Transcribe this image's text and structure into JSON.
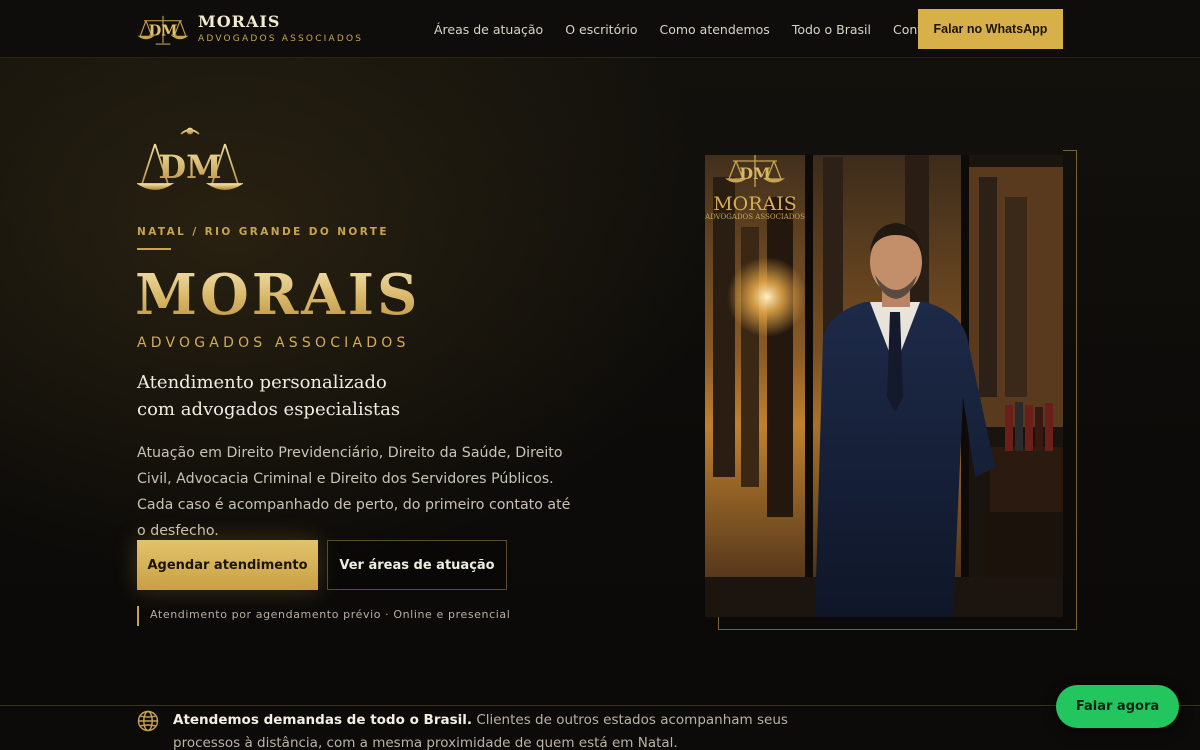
{
  "nav": {
    "brand_name": "MORAIS",
    "brand_sub": "ADVOGADOS ASSOCIADOS",
    "links": [
      "Áreas de atuação",
      "O escritório",
      "Como atendemos",
      "Todo o Brasil",
      "Contato"
    ],
    "cta": "Falar no WhatsApp"
  },
  "hero": {
    "eyebrow": "NATAL / RIO GRANDE DO NORTE",
    "title": "MORAIS",
    "subtitle": "ADVOGADOS ASSOCIADOS",
    "tagline_line1": "Atendimento personalizado",
    "tagline_line2": "com advogados especialistas",
    "description": "Atuação em Direito Previdenciário, Direito da Saúde, Direito Civil, Advocacia Criminal e Direito dos Servidores Públicos. Cada caso é acompanhado de perto, do primeiro contato até o desfecho.",
    "primary_button": "Agendar atendimento",
    "secondary_button": "Ver áreas de atuação",
    "note": "Atendimento por agendamento prévio · Online e presencial",
    "photo_logo_text": "MORAIS",
    "photo_logo_sub": "ADVOGADOS ASSOCIADOS"
  },
  "bottom": {
    "bold_text": "Atendemos demandas de todo o Brasil.",
    "text": " Clientes de outros estados acompanham seus processos à distância, com a mesma proximidade de quem está em Natal."
  },
  "floating": {
    "label": "Falar agora"
  },
  "colors": {
    "gold": "#c9a44f",
    "background": "#0d0c0a",
    "whatsapp": "#22c55e"
  },
  "icons": {
    "logo": "scales-monogram-logo",
    "bottom": "globe-icon"
  }
}
